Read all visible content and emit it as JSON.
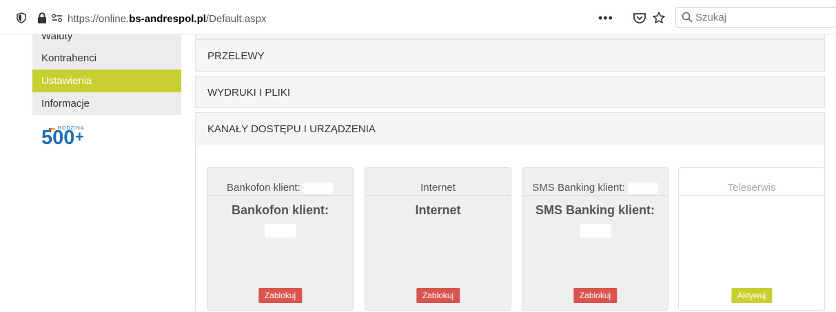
{
  "browser": {
    "url_prefix": "https://online.",
    "url_domain": "bs-andrespol.pl",
    "url_path": "/Default.aspx",
    "more_label": "•••",
    "search_placeholder": "Szukaj"
  },
  "sidebar": {
    "items": [
      {
        "label": "Waluty",
        "active": false
      },
      {
        "label": "Kontrahenci",
        "active": false
      },
      {
        "label": "Ustawienia",
        "active": true
      },
      {
        "label": "Informacje",
        "active": false
      }
    ],
    "logo_number": "500",
    "logo_plus": "+",
    "logo_word": "RODZINA"
  },
  "sections": [
    {
      "label": "PRZELEWY"
    },
    {
      "label": "WYDRUKI I PLIKI"
    },
    {
      "label": "KANAŁY DOSTĘPU I URZĄDZENIA"
    }
  ],
  "cards": [
    {
      "head": "Bankofon klient:",
      "title": "Bankofon klient:",
      "button": "Zablokuj"
    },
    {
      "head": "Internet",
      "title": "Internet",
      "button": "Zablokuj"
    },
    {
      "head": "SMS Banking klient:",
      "title": "SMS Banking klient:",
      "button": "Zablokuj"
    },
    {
      "head": "Teleserwis",
      "title": "",
      "button": "Aktywuj"
    }
  ],
  "colors": {
    "active_nav": "#c8cf30",
    "block_button": "#d9534f",
    "activate_button": "#c8cf30",
    "logo_blue": "#1e6fb5"
  }
}
